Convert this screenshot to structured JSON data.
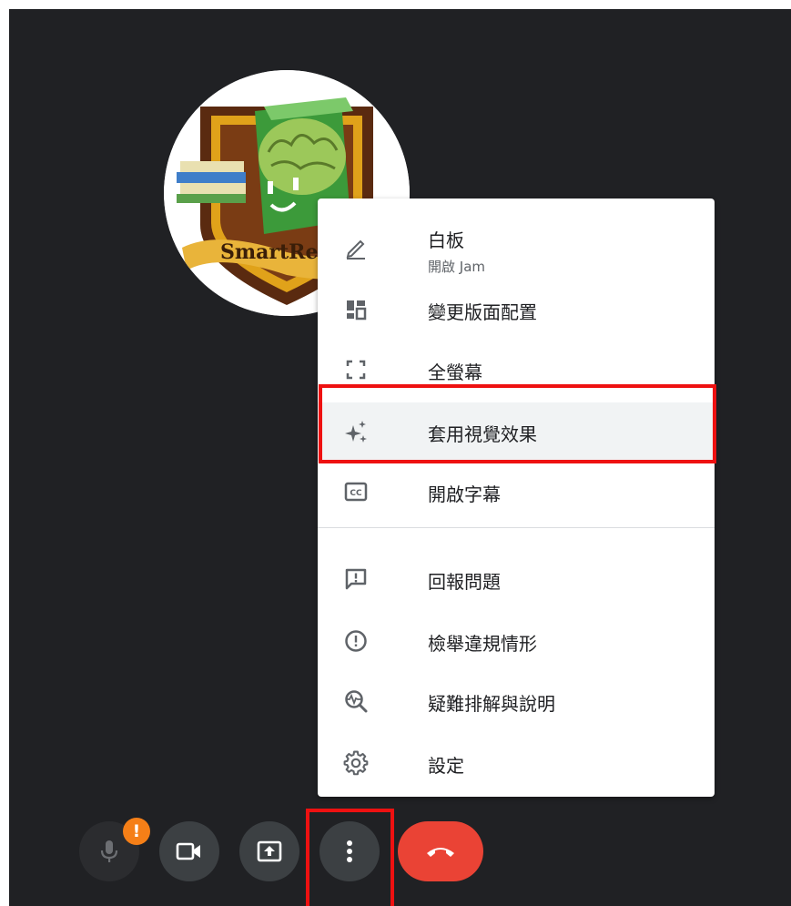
{
  "avatar": {
    "logo_text": "SmartRea"
  },
  "menu": {
    "items": [
      {
        "label": "白板",
        "sublabel": "開啟 Jam",
        "icon": "pencil-icon"
      },
      {
        "label": "變更版面配置",
        "icon": "layout-icon"
      },
      {
        "label": "全螢幕",
        "icon": "fullscreen-icon"
      },
      {
        "label": "套用視覺效果",
        "icon": "sparkle-icon",
        "highlighted": true
      },
      {
        "label": "開啟字幕",
        "icon": "captions-icon"
      },
      {
        "label": "回報問題",
        "icon": "feedback-icon"
      },
      {
        "label": "檢舉違規情形",
        "icon": "report-icon"
      },
      {
        "label": "疑難排解與說明",
        "icon": "troubleshoot-icon"
      },
      {
        "label": "設定",
        "icon": "gear-icon"
      }
    ]
  },
  "controls": {
    "mic": {
      "icon": "microphone-icon",
      "badge": "!"
    },
    "camera": {
      "icon": "camera-icon"
    },
    "present": {
      "icon": "present-screen-icon"
    },
    "more": {
      "icon": "more-vertical-icon"
    },
    "hangup": {
      "icon": "hang-up-icon"
    }
  },
  "colors": {
    "background": "#202124",
    "menu_background": "#ffffff",
    "highlight_box": "#ee1111",
    "hangup": "#ea4335",
    "badge": "#f57f17"
  }
}
